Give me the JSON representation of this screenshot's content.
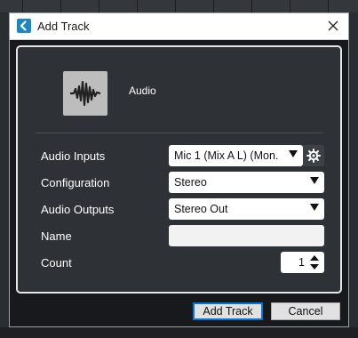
{
  "window": {
    "title": "Add Track",
    "app_icon": "cubase-logo-icon",
    "close_icon": "close-icon"
  },
  "track_type": {
    "icon": "audio-waveform-icon",
    "label": "Audio"
  },
  "fields": {
    "audio_inputs": {
      "label": "Audio Inputs",
      "value": "Mic 1 (Mix A L) (Mon."
    },
    "configuration": {
      "label": "Configuration",
      "value": "Stereo"
    },
    "audio_outputs": {
      "label": "Audio Outputs",
      "value": "Stereo Out"
    },
    "name": {
      "label": "Name",
      "value": ""
    },
    "count": {
      "label": "Count",
      "value": "1"
    }
  },
  "buttons": {
    "add_track": "Add Track",
    "cancel": "Cancel"
  },
  "colors": {
    "accent": "#0078d7",
    "app_icon_bg": "#1c86c8",
    "dialog_bg": "#17191c",
    "panel_bg": "#2e3135"
  }
}
